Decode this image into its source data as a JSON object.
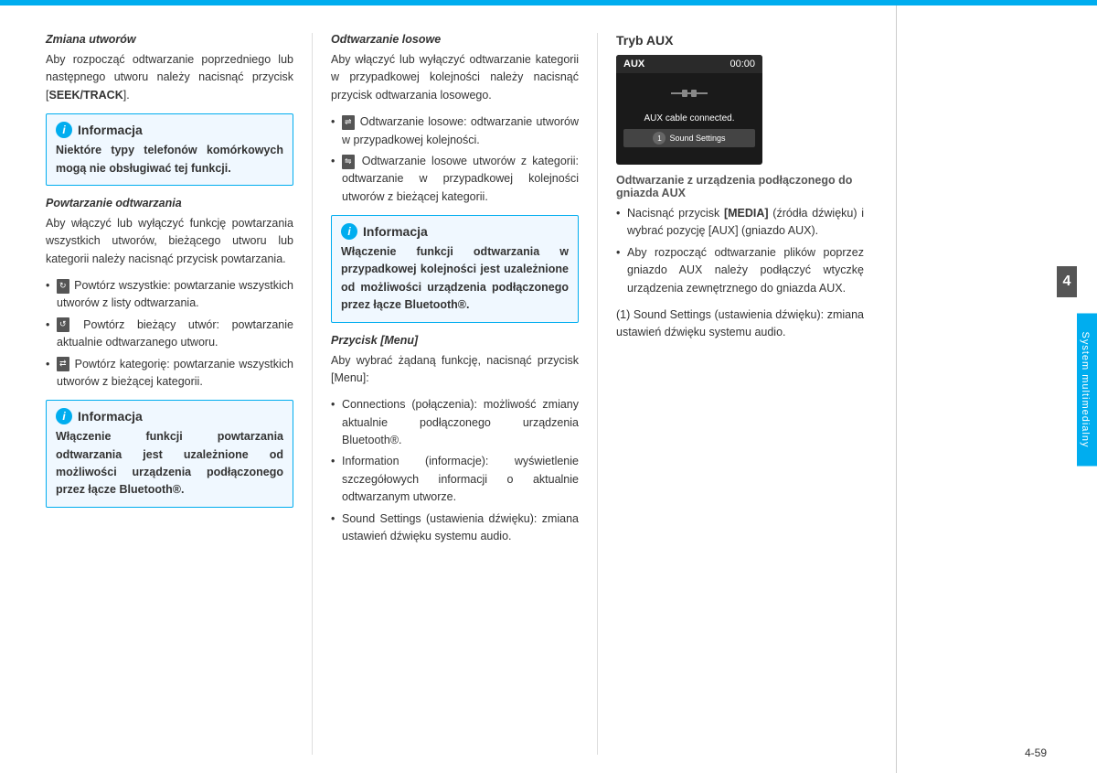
{
  "topbar": {},
  "col1": {
    "section1": {
      "title": "Zmiana utworów",
      "text": "Aby rozpocząć odtwarzanie poprzedniego lub następnego utworu należy nacisnąć przycisk [",
      "seek_label": "SEEK/TRACK",
      "text_after": "]."
    },
    "info1": {
      "icon": "i",
      "title": "Informacja",
      "text": "Niektóre typy telefonów komórkowych mogą nie obsługiwać tej funkcji."
    },
    "section2": {
      "title": "Powtarzanie odtwarzania",
      "text": "Aby włączyć lub wyłączyć funkcję powtarzania wszystkich utworów, bieżącego utworu lub kategorii należy nacisnąć przycisk powtarzania.",
      "bullets": [
        "Powtórz wszystkie: powtarzanie wszystkich utworów z listy odtwarzania.",
        "Powtórz bieżący utwór: powtarzanie aktualnie odtwarzanego utworu.",
        "Powtórz kategorię: powtarzanie wszystkich utworów z bieżącej kategorii."
      ]
    },
    "info2": {
      "icon": "i",
      "title": "Informacja",
      "text": "Włączenie funkcji powtarzania odtwarzania jest uzależnione od możliwości urządzenia podłączonego przez łącze Bluetooth®."
    }
  },
  "col2": {
    "section1": {
      "title": "Odtwarzanie losowe",
      "text": "Aby włączyć lub wyłączyć odtwarzanie kategorii w przypadkowej kolejności należy nacisnąć przycisk odtwarzania losowego.",
      "bullets": [
        "Odtwarzanie losowe: odtwarzanie utworów w przypadkowej kolejności.",
        "Odtwarzanie losowe utworów z kategorii: odtwarzanie w przypadkowej kolejności utworów z bieżącej kategorii."
      ]
    },
    "info1": {
      "icon": "i",
      "title": "Informacja",
      "text": "Włączenie funkcji odtwarzania w przypadkowej kolejności jest uzależnione od możliwości urządzenia podłączonego przez łącze Bluetooth®."
    },
    "section2": {
      "title": "Przycisk [Menu]",
      "text": "Aby wybrać żądaną funkcję, nacisnąć przycisk [Menu]:",
      "bullets": [
        "Connections (połączenia): możliwość zmiany aktualnie podłączonego urządzenia Bluetooth®.",
        "Information (informacje): wyświetlenie szczegółowych informacji o aktualnie odtwarzanym utworze.",
        "Sound Settings (ustawienia dźwięku): zmiana ustawień dźwięku systemu audio."
      ]
    }
  },
  "col3": {
    "tryb_aux": {
      "title": "Tryb AUX",
      "screen": {
        "label": "AUX",
        "time": "00:00",
        "connected_text": "AUX cable connected.",
        "button_label": "Sound Settings",
        "button_num": "1"
      }
    },
    "section1": {
      "title": "Odtwarzanie z urządzenia podłączonego do gniazda AUX",
      "bullets": [
        "Nacisnąć przycisk [MEDIA] (źródła dźwięku) i wybrać pozycję [AUX] (gniazdo AUX).",
        "Aby rozpocząć odtwarzanie plików poprzez gniazdo AUX należy podłączyć wtyczkę urządzenia zewnętrznego do gniazda AUX."
      ],
      "footnote_num": "(1)",
      "footnote_text": "Sound Settings (ustawienia dźwięku): zmiana ustawień dźwięku systemu audio."
    }
  },
  "sidebar": {
    "chapter_number": "4",
    "chapter_label": "System multimedialny"
  },
  "page_number": "4-59"
}
